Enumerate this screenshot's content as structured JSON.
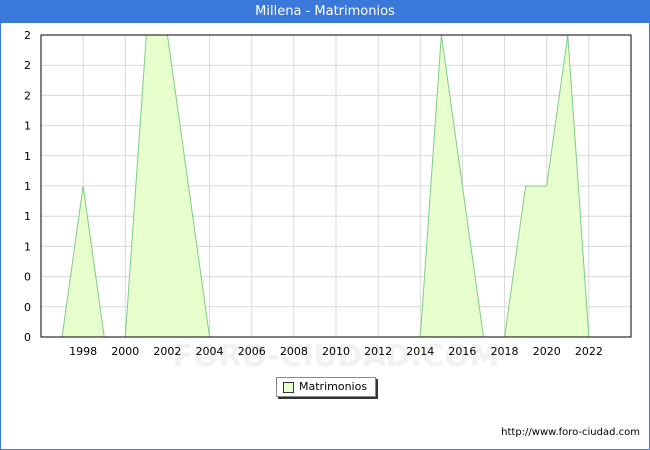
{
  "window": {
    "title": "Millena - Matrimonios"
  },
  "footer": {
    "source": "http://www.foro-ciudad.com"
  },
  "watermark": "FORO-CIUDAD.COM",
  "colors": {
    "title_bar": "#3a78d9",
    "area_fill": "#e6ffcc",
    "area_line": "#7fcc8a",
    "grid": "#d9d9d9"
  },
  "chart_data": {
    "type": "area",
    "title": "Millena - Matrimonios",
    "xlabel": "",
    "ylabel": "",
    "x": [
      1997,
      1998,
      1999,
      2000,
      2001,
      2002,
      2003,
      2004,
      2005,
      2006,
      2007,
      2008,
      2009,
      2010,
      2011,
      2012,
      2013,
      2014,
      2015,
      2016,
      2017,
      2018,
      2019,
      2020,
      2021,
      2022
    ],
    "series": [
      {
        "name": "Matrimonios",
        "values": [
          0,
          1,
          0,
          0,
          2,
          2,
          1,
          0,
          0,
          0,
          0,
          0,
          0,
          0,
          0,
          0,
          0,
          0,
          2,
          1,
          0,
          0,
          1,
          1,
          2,
          0
        ]
      }
    ],
    "xlim": [
      1996,
      2024
    ],
    "ylim": [
      0,
      2
    ],
    "x_ticks": [
      1998,
      2000,
      2002,
      2004,
      2006,
      2008,
      2010,
      2012,
      2014,
      2016,
      2018,
      2020,
      2022
    ],
    "y_tick_labels": [
      "0",
      "0",
      "0",
      "1",
      "1",
      "1",
      "1",
      "1",
      "2",
      "2",
      "2"
    ],
    "grid": true,
    "legend": {
      "position": "bottom-center",
      "entries": [
        "Matrimonios"
      ]
    }
  }
}
